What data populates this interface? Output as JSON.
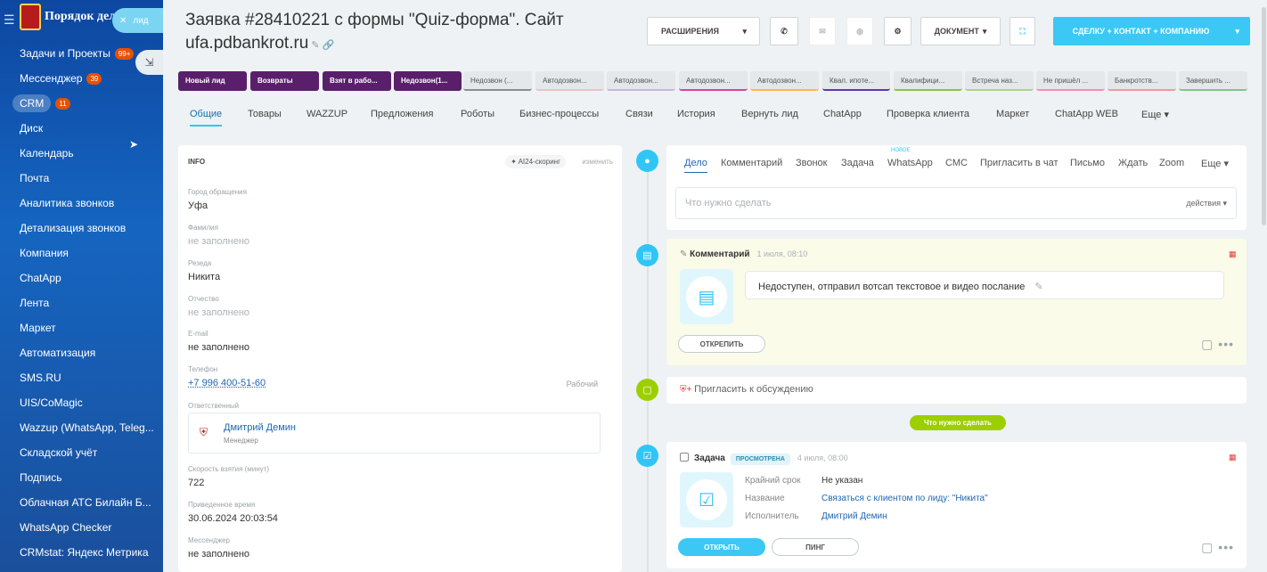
{
  "sidebar": {
    "brand": "Порядок дел",
    "items": [
      {
        "label": "Задачи и Проекты",
        "count": "99+"
      },
      {
        "label": "Мессенджер",
        "count": "39"
      },
      {
        "label": "CRM",
        "count": "11"
      },
      {
        "label": "Диск"
      },
      {
        "label": "Календарь"
      },
      {
        "label": "Почта"
      },
      {
        "label": "Аналитика звонков"
      },
      {
        "label": "Детализация звонков"
      },
      {
        "label": "Компания"
      },
      {
        "label": "ChatApp"
      },
      {
        "label": "Лента"
      },
      {
        "label": "Маркет"
      },
      {
        "label": "Автоматизация"
      },
      {
        "label": "SMS.RU"
      },
      {
        "label": "UIS/CoMagic"
      },
      {
        "label": "Wazzup (WhatsApp, Teleg..."
      },
      {
        "label": "Складской учёт"
      },
      {
        "label": "Подпись"
      },
      {
        "label": "Облачная АТС Билайн Б..."
      },
      {
        "label": "WhatsApp Checker"
      },
      {
        "label": "CRMstat: Яндекс Метрика"
      }
    ]
  },
  "leadtag": {
    "close": "✕",
    "label": "лид"
  },
  "header": {
    "title": "Заявка #28410221 с формы \"Quiz-форма\". Сайт ufa.pdbankrot.ru",
    "extensions_label": "РАСШИРЕНИЯ",
    "document_label": "ДОКУМЕНТ",
    "convert_label": "СДЕЛКУ + КОНТАКТ + КОМПАНИЮ"
  },
  "stages": [
    "Новый лид",
    "Возвраты",
    "Взят в рабо...",
    "Недозвон(1...",
    "Недозвон (...",
    "Автодозвон...",
    "Автодозвон...",
    "Автодозвон...",
    "Автодозвон...",
    "Квал. ипоте...",
    "Квалифици...",
    "Встреча наз...",
    "Не пришёл ...",
    "Банкротств...",
    "Завершить ..."
  ],
  "tabs": [
    "Общие",
    "Товары",
    "WAZZUP",
    "Предложения",
    "Роботы",
    "Бизнес-процессы",
    "Связи",
    "История",
    "Вернуть лид",
    "ChatApp",
    "Проверка клиента",
    "Маркет",
    "ChatApp WEB",
    "Еще"
  ],
  "info": {
    "header": "INFO",
    "ai_label": "AI24-скоринг",
    "edit_label": "изменить",
    "fields": [
      {
        "label": "Город обращения",
        "value": "Уфа"
      },
      {
        "label": "Фамилия",
        "value": "не заполнено"
      },
      {
        "label": "Резеда",
        "value": "Никита"
      },
      {
        "label": "Отчество",
        "value": "не заполнено"
      },
      {
        "label": "E-mail",
        "value": "не заполнено"
      },
      {
        "label": "Телефон",
        "value": "+7 996 400-51-60",
        "extra": "Рабочий"
      }
    ],
    "responsible_label": "Ответственный",
    "responsible_name": "Дмитрий Демин",
    "responsible_role": "Менеджер",
    "fields2": [
      {
        "label": "Скорость взятия (минут)",
        "value": "722"
      },
      {
        "label": "Приведенное время",
        "value": "30.06.2024 20:03:54"
      },
      {
        "label": "Мессенджер",
        "value": "не заполнено"
      }
    ]
  },
  "composer": {
    "tabs": [
      "Дело",
      "Комментарий",
      "Звонок",
      "Задача",
      "WhatsApp",
      "СМС",
      "Пригласить в чат",
      "Письмо",
      "Ждать",
      "Zoom",
      "Еще"
    ],
    "new_tag": "НОВОЕ",
    "placeholder": "Что нужно сделать",
    "actions": "действия"
  },
  "comment": {
    "title": "Комментарий",
    "time": "1 июля, 08:10",
    "text": "Недоступен, отправил вотсап текстовое и видео послание",
    "unpin": "ОТКРЕПИТЬ"
  },
  "invite": {
    "label": "Пригласить к обсуждению"
  },
  "separator": "Что нужно сделать",
  "task": {
    "title": "Задача",
    "badge": "ПРОСМОТРЕНА",
    "time": "4 июля, 08:00",
    "deadline_label": "Крайний срок",
    "deadline_value": "Не указан",
    "name_label": "Название",
    "name_value": "Связаться с клиентом по лиду: \"Никита\"",
    "assignee_label": "Исполнитель",
    "assignee_value": "Дмитрий Демин",
    "open": "ОТКРЫТЬ",
    "ping": "ПИНГ"
  },
  "colors": {
    "sidebar": "#0d47a1",
    "accent": "#2fc6f6",
    "stage_done": "#5a1f6b",
    "green": "#9dcf00"
  }
}
